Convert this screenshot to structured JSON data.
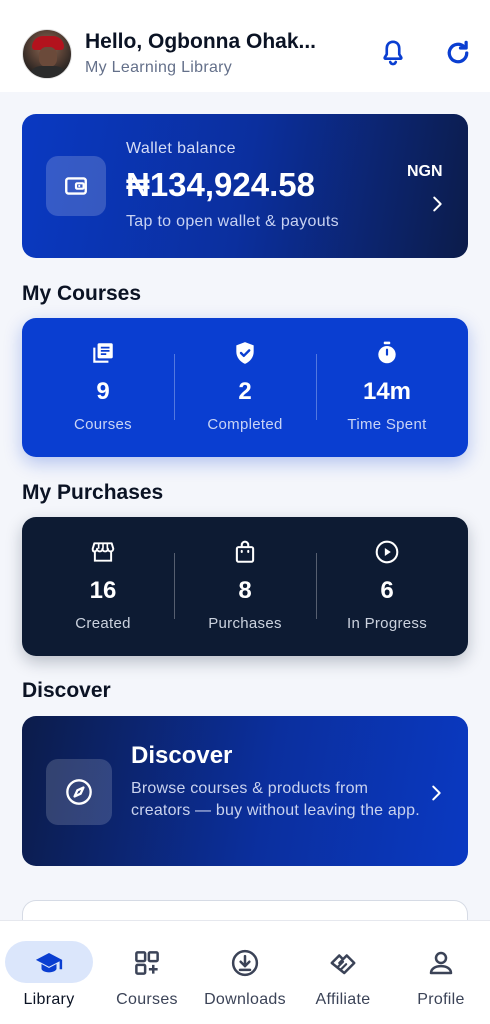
{
  "header": {
    "greeting": "Hello, Ogbonna Ohak...",
    "subtitle": "My Learning Library",
    "icons": {
      "notifications": "bell-icon",
      "refresh": "refresh-icon"
    }
  },
  "wallet": {
    "label": "Wallet balance",
    "balance": "₦134,924.58",
    "hint": "Tap to open wallet & payouts",
    "currency": "NGN",
    "icon": "wallet-icon"
  },
  "sections": {
    "my_courses": "My Courses",
    "my_purchases": "My Purchases",
    "discover": "Discover"
  },
  "courses_stats": [
    {
      "icon": "library-books-icon",
      "value": "9",
      "label": "Courses"
    },
    {
      "icon": "verified-shield-icon",
      "value": "2",
      "label": "Completed"
    },
    {
      "icon": "stopwatch-icon",
      "value": "14m",
      "label": "Time Spent"
    }
  ],
  "purchase_stats": [
    {
      "icon": "storefront-icon",
      "value": "16",
      "label": "Created"
    },
    {
      "icon": "shopping-bag-icon",
      "value": "8",
      "label": "Purchases"
    },
    {
      "icon": "play-circle-icon",
      "value": "6",
      "label": "In Progress"
    }
  ],
  "discover_card": {
    "title": "Discover",
    "description": "Browse courses & products from creators — buy without leaving the app.",
    "icon": "compass-icon"
  },
  "bottom_nav": [
    {
      "label": "Library",
      "icon": "graduation-cap-icon",
      "active": true
    },
    {
      "label": "Courses",
      "icon": "grid-add-icon",
      "active": false
    },
    {
      "label": "Downloads",
      "icon": "download-circle-icon",
      "active": false
    },
    {
      "label": "Affiliate",
      "icon": "handshake-icon",
      "active": false
    },
    {
      "label": "Profile",
      "icon": "person-icon",
      "active": false
    }
  ],
  "colors": {
    "primary": "#0a3ed1",
    "dark": "#0d1b33",
    "background": "#f4f6fb",
    "nav_active_pill": "#dbe6fb"
  }
}
